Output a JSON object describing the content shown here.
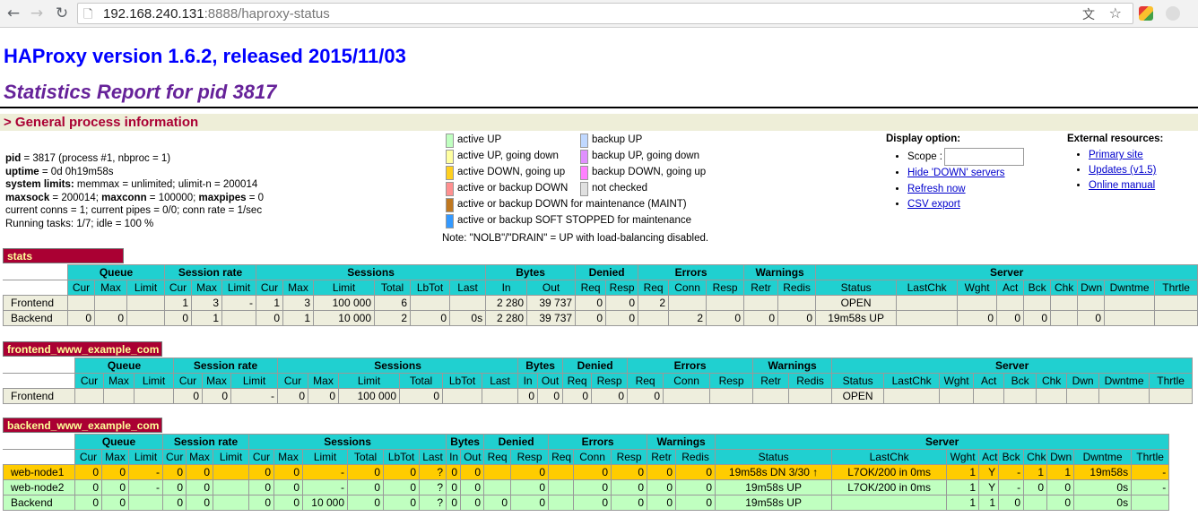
{
  "browser": {
    "url_host": "192.168.240.131",
    "url_rest": ":8888/haproxy-status"
  },
  "page": {
    "title": "HAProxy version 1.6.2, released 2015/11/03",
    "subtitle": "Statistics Report for pid 3817",
    "section": "> General process information"
  },
  "process_info": {
    "pid_label": "pid",
    "pid_value": " = 3817 (process #1, nbproc = 1)",
    "uptime_label": "uptime",
    "uptime_value": " = 0d 0h19m58s",
    "syslimits_label": "system limits:",
    "syslimits_value": " memmax = unlimited; ulimit-n = 200014",
    "maxsock_label": "maxsock",
    "maxsock_value": " = 200014; ",
    "maxconn_label": "maxconn",
    "maxconn_value": " = 100000; ",
    "maxpipes_label": "maxpipes",
    "maxpipes_value": " = 0",
    "conns_line": "current conns = 1; current pipes = 0/0; conn rate = 1/sec",
    "tasks_line": "Running tasks: 1/7; idle = 100 %"
  },
  "legend": {
    "items": [
      {
        "label": "active UP",
        "color": "#c0ffc0"
      },
      {
        "label": "active UP, going down",
        "color": "#ffffa0"
      },
      {
        "label": "active DOWN, going up",
        "color": "#ffd020"
      },
      {
        "label": "active or backup DOWN",
        "color": "#ff9090"
      },
      {
        "label": "active or backup DOWN for maintenance (MAINT)",
        "color": "#c07820"
      },
      {
        "label": "active or backup SOFT STOPPED for maintenance",
        "color": "#3399ff"
      },
      {
        "label": "backup UP",
        "color": "#c0d8ff"
      },
      {
        "label": "backup UP, going down",
        "color": "#e090ff"
      },
      {
        "label": "backup DOWN, going up",
        "color": "#ff80ff"
      },
      {
        "label": "not checked",
        "color": "#e0e0e0"
      }
    ],
    "note": "Note: \"NOLB\"/\"DRAIN\" = UP with load-balancing disabled."
  },
  "display_options": {
    "title": "Display option:",
    "scope_label": "Scope :",
    "hide_down": "Hide 'DOWN' servers",
    "refresh": "Refresh now",
    "csv": "CSV export"
  },
  "external": {
    "title": "External resources:",
    "primary": "Primary site",
    "updates": "Updates (v1.5)",
    "manual": "Online manual"
  },
  "headers": {
    "groups": [
      "Queue",
      "Session rate",
      "Sessions",
      "Bytes",
      "Denied",
      "Errors",
      "Warnings",
      "Server"
    ],
    "cols": [
      "Cur",
      "Max",
      "Limit",
      "Cur",
      "Max",
      "Limit",
      "Cur",
      "Max",
      "Limit",
      "Total",
      "LbTot",
      "Last",
      "In",
      "Out",
      "Req",
      "Resp",
      "Req",
      "Conn",
      "Resp",
      "Retr",
      "Redis",
      "Status",
      "LastChk",
      "Wght",
      "Act",
      "Bck",
      "Chk",
      "Dwn",
      "Dwntme",
      "Thrtle"
    ]
  },
  "proxies": [
    {
      "name": "stats",
      "rows": [
        {
          "name": "Frontend",
          "cells": [
            "",
            "",
            "",
            "1",
            "3",
            "-",
            "1",
            "3",
            "100 000",
            "6",
            "",
            "",
            "2 280",
            "39 737",
            "0",
            "0",
            "2",
            "",
            "",
            "",
            "",
            "OPEN",
            "",
            "",
            "",
            "",
            "",
            "",
            "",
            ""
          ]
        },
        {
          "name": "Backend",
          "cells": [
            "0",
            "0",
            "",
            "0",
            "1",
            "",
            "0",
            "1",
            "10 000",
            "2",
            "0",
            "0s",
            "2 280",
            "39 737",
            "0",
            "0",
            "",
            "2",
            "0",
            "0",
            "0",
            "19m58s UP",
            "",
            "0",
            "0",
            "0",
            "",
            "0",
            "",
            ""
          ]
        }
      ]
    },
    {
      "name": "frontend_www_example_com",
      "rows": [
        {
          "name": "Frontend",
          "cells": [
            "",
            "",
            "",
            "0",
            "0",
            "-",
            "0",
            "0",
            "100 000",
            "0",
            "",
            "",
            "0",
            "0",
            "0",
            "0",
            "0",
            "",
            "",
            "",
            "",
            "OPEN",
            "",
            "",
            "",
            "",
            "",
            "",
            "",
            ""
          ]
        }
      ]
    },
    {
      "name": "backend_www_example_com",
      "rows": [
        {
          "name": "web-node1",
          "cells": [
            "0",
            "0",
            "-",
            "0",
            "0",
            "",
            "0",
            "0",
            "-",
            "0",
            "0",
            "?",
            "0",
            "0",
            "",
            "0",
            "",
            "0",
            "0",
            "0",
            "0",
            "19m58s DN 3/30 ↑",
            "L7OK/200 in 0ms",
            "1",
            "Y",
            "-",
            "1",
            "1",
            "19m58s",
            "-"
          ]
        },
        {
          "name": "web-node2",
          "cells": [
            "0",
            "0",
            "-",
            "0",
            "0",
            "",
            "0",
            "0",
            "-",
            "0",
            "0",
            "?",
            "0",
            "0",
            "",
            "0",
            "",
            "0",
            "0",
            "0",
            "0",
            "19m58s UP",
            "L7OK/200 in 0ms",
            "1",
            "Y",
            "-",
            "0",
            "0",
            "0s",
            "-"
          ]
        },
        {
          "name": "Backend",
          "cells": [
            "0",
            "0",
            "",
            "0",
            "0",
            "",
            "0",
            "0",
            "10 000",
            "0",
            "0",
            "?",
            "0",
            "0",
            "0",
            "0",
            "",
            "0",
            "0",
            "0",
            "0",
            "19m58s UP",
            "",
            "1",
            "1",
            "0",
            "",
            "0",
            "0s",
            ""
          ]
        }
      ]
    }
  ]
}
